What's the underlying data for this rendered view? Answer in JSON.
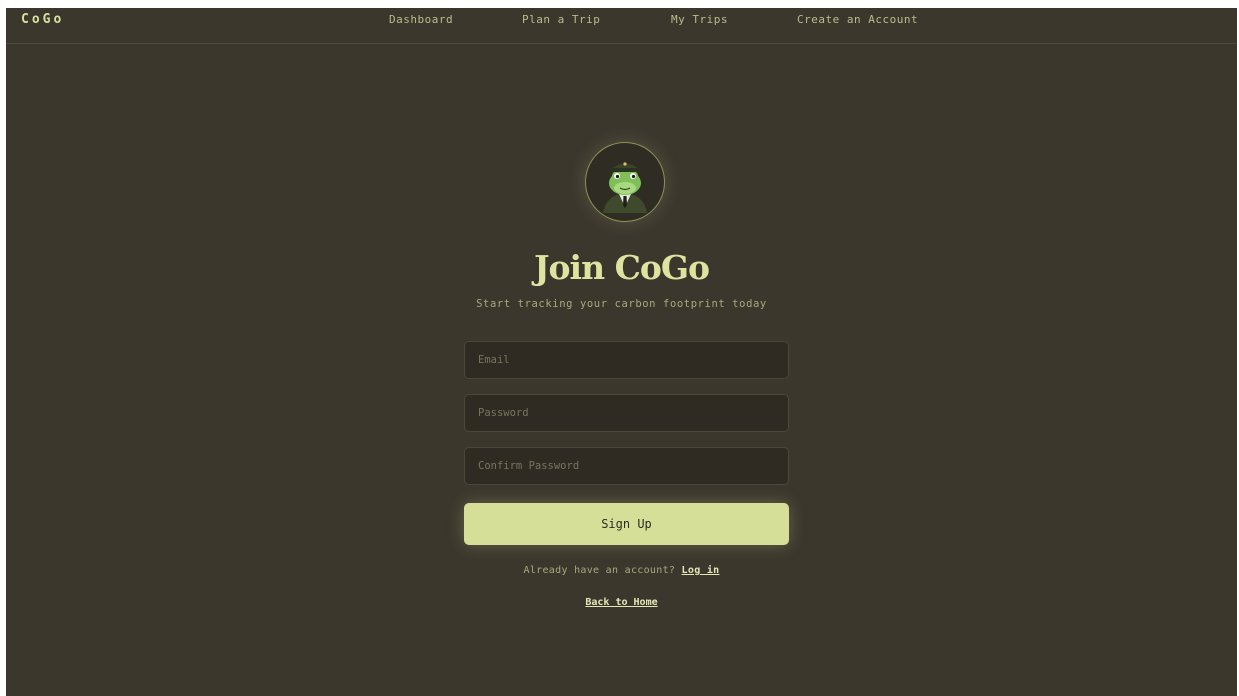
{
  "nav": {
    "brand": "CoGo",
    "links": [
      "Dashboard",
      "Plan a Trip",
      "My Trips",
      "Create an Account"
    ]
  },
  "signup": {
    "title": "Join CoGo",
    "subtitle": "Start tracking your carbon footprint today",
    "email_placeholder": "Email",
    "password_placeholder": "Password",
    "confirm_placeholder": "Confirm Password",
    "submit_label": "Sign Up",
    "login_prompt": "Already have an account?",
    "login_link": "Log in",
    "back_link": "Back to Home"
  },
  "avatar": {
    "icon": "frog-officer-icon"
  },
  "colors": {
    "background": "#3b372d",
    "accent": "#d6df98",
    "input_bg": "#2f2b22",
    "muted_text": "#a7a97e"
  }
}
